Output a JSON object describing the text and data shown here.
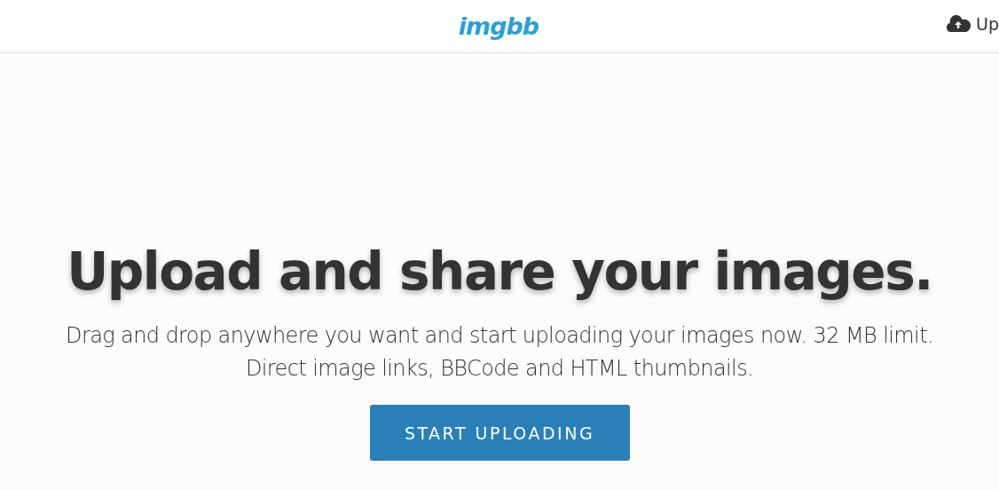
{
  "header": {
    "logo": "imgbb",
    "upload_link": "Up"
  },
  "hero": {
    "title": "Upload and share your images.",
    "subtitle": "Drag and drop anywhere you want and start uploading your images now. 32 MB limit. Direct image links, BBCode and HTML thumbnails.",
    "button": "START UPLOADING"
  }
}
